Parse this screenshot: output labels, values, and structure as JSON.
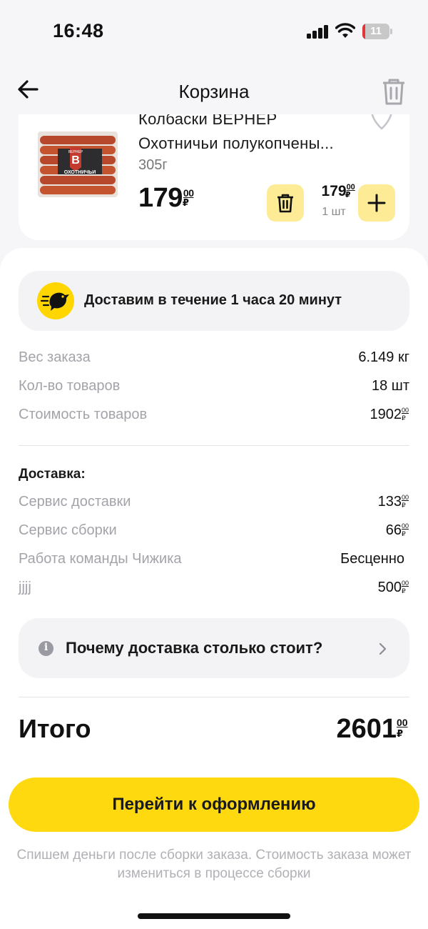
{
  "status_bar": {
    "time": "16:48",
    "battery_level": "11",
    "battery_fraction": 0.11,
    "battery_color": "#e5333a",
    "icons": [
      "signal-icon",
      "wifi-icon",
      "battery-icon"
    ]
  },
  "header": {
    "title": "Корзина",
    "back_icon": "arrow-left-icon",
    "clear_icon": "trash-icon"
  },
  "product": {
    "name_line1": "Колбаски ВЕРНЕР",
    "name_line2": "Охотничьи полукопчены...",
    "weight": "305г",
    "price_rub": "179",
    "price_kop": "00",
    "currency": "₽",
    "unit_price_rub": "179",
    "unit_price_kop": "00",
    "quantity": "1 шт",
    "image_brand": "ВЕРНЕР",
    "image_label": "ОХОТНИЧЬИ",
    "image_letter": "В"
  },
  "delivery": {
    "banner_text": "Доставим в течение 1 часа 20 минут",
    "banner_icon": "bird-icon"
  },
  "summary": {
    "weight_label": "Вес заказа",
    "weight_value": "6.149 кг",
    "count_label": "Кол-во товаров",
    "count_value": "18 шт",
    "goods_label": "Стоимость товаров",
    "goods_value": "1902",
    "goods_kop": "00"
  },
  "delivery_section": {
    "title": "Доставка:",
    "service_label": "Сервис доставки",
    "service_value": "133",
    "service_kop": "00",
    "assembly_label": "Сервис сборки",
    "assembly_value": "66",
    "assembly_kop": "00",
    "team_label": "Работа команды Чижика",
    "team_value": "Бесценно",
    "extra_label": "jjjj",
    "extra_value": "500",
    "extra_kop": "00"
  },
  "why": {
    "text": "Почему доставка столько стоит?",
    "info_glyph": "i"
  },
  "total": {
    "label": "Итого",
    "value": "2601",
    "kop": "00"
  },
  "checkout": {
    "button_label": "Перейти к оформлению",
    "footnote": "Спишем деньги после сборки заказа. Стоимость заказа может измениться в процессе сборки"
  },
  "colors": {
    "accent_yellow": "#ffd90f",
    "button_soft_yellow": "#fdeb96",
    "muted_text": "#a3a3aa"
  }
}
